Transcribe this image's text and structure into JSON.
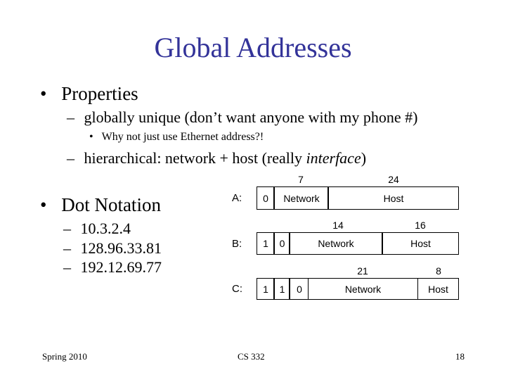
{
  "slide": {
    "title": "Global Addresses",
    "bullets": [
      {
        "text": "Properties",
        "sub": [
          {
            "text": "globally unique (don’t want anyone with my phone #)",
            "sub": [
              {
                "text": "Why not just use Ethernet address?!"
              }
            ]
          },
          {
            "text_prefix": "hierarchical: network + host (really ",
            "text_italic": "interface",
            "text_suffix": ")"
          }
        ]
      },
      {
        "text": "Dot Notation",
        "sub": [
          {
            "text": "10.3.2.4"
          },
          {
            "text": "128.96.33.81"
          },
          {
            "text": "192.12.69.77"
          }
        ]
      }
    ],
    "bullet_glyph": "•",
    "dash_glyph": "–"
  },
  "address_classes": [
    {
      "label": "A:",
      "prefix_bits": [
        "0"
      ],
      "network_bits": "7",
      "host_bits": "24",
      "network_label": "Network",
      "host_label": "Host"
    },
    {
      "label": "B:",
      "prefix_bits": [
        "1",
        "0"
      ],
      "network_bits": "14",
      "host_bits": "16",
      "network_label": "Network",
      "host_label": "Host"
    },
    {
      "label": "C:",
      "prefix_bits": [
        "1",
        "1",
        "0"
      ],
      "network_bits": "21",
      "host_bits": "8",
      "network_label": "Network",
      "host_label": "Host"
    }
  ],
  "footer": {
    "left": "Spring 2010",
    "center": "CS 332",
    "right": "18"
  },
  "colors": {
    "title": "#333399"
  }
}
